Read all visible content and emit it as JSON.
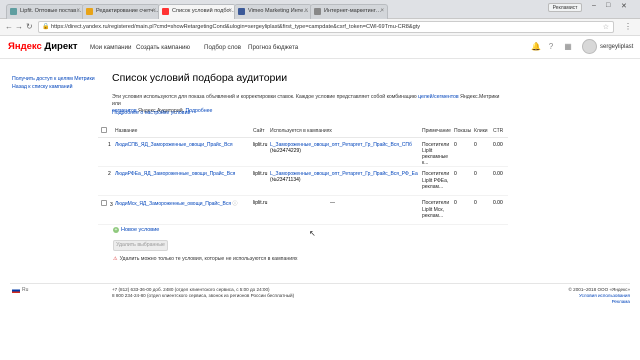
{
  "browser": {
    "tabs": [
      {
        "title": "Lipfit. Оптовые постав…",
        "favicon_color": "#5f9ea0"
      },
      {
        "title": "Редактирование счетч…",
        "favicon_color": "#e8a317"
      },
      {
        "title": "Список условий подбо…",
        "favicon_color": "#f33"
      },
      {
        "title": "Vimeo Marketing Инте…",
        "favicon_color": "#3b5998"
      },
      {
        "title": "Интернет-маркетинг…",
        "favicon_color": "#888"
      }
    ],
    "profile_chip": "Рекламист",
    "url": "https://direct.yandex.ru/registered/main.pl?cmd=showRetargetingCond&ulogin=sergeyliplast&first_type=campdate&csrf_token=CWl-69Tmu-CR8&gty"
  },
  "header": {
    "logo_ya": "Яндекс",
    "logo_rest": " Директ",
    "nav": [
      "Мои кампании",
      "Создать кампанию",
      "Подбор слов",
      "Прогноз бюджета"
    ],
    "username": "sergeyliplast"
  },
  "sidebar": {
    "links": [
      "Получить доступ к целям Метрики",
      "Назад к списку кампаний"
    ]
  },
  "main": {
    "title": "Список условий подбора аудитории",
    "desc_1": "Эти условия используются для показа объявлений и корректировки ставок. Каждое условие представляет собой комбинацию ",
    "desc_link_1": "целей/сегментов",
    "desc_2": " Яндекс.Метрики или",
    "desc_link_2": "сегментов",
    "desc_3": " Яндекс.Аудиторий. ",
    "desc_link_3": "Подробнее",
    "settings_link": "Подробнее о настройке условий",
    "columns": [
      "Название",
      "Сайт",
      "Используется в кампаниях",
      "Примечание",
      "Показы",
      "Клики",
      "CTR"
    ],
    "rows": [
      {
        "num": "1",
        "name": "ЛюдиСПБ_ЯД_Замороженные_овощи_Прайс_Вся",
        "site": "liplit.ru",
        "campaign": "L_Замороженные_овощи_опт_Ретаргет_Гр_Прайс_Вся_СПб",
        "campaign_id": "(№23474229)",
        "note": "Посетители Liplit рекламные к...",
        "shows": "0",
        "clicks": "0",
        "ctr": "0.00"
      },
      {
        "num": "2",
        "name": "ЛюдиРФЕа_ЯД_Замороженные_овощи_Прайс_Вся",
        "site": "liplit.ru",
        "campaign": "L_Замороженные_овощи_опт_Ретаргет_Гр_Прайс_Вся_РФ_Ea",
        "campaign_id": "(№23471134)",
        "note": "Посетители Liplit РФЕа, реклам...",
        "shows": "0",
        "clicks": "0",
        "ctr": "0.00"
      },
      {
        "num": "3",
        "name": "ЛюдиМск_ЯД_Замороженные_овощи_Прайс_Вся",
        "site": "liplit.ru",
        "campaign": "—",
        "campaign_id": "",
        "note": "Посетители Liplit Мск, реклам...",
        "shows": "0",
        "clicks": "0",
        "ctr": "0.00"
      }
    ],
    "new_condition": "Новое условие",
    "delete_button": "Удалить выбранные",
    "warning": "Удалить можно только те условия, которые не используются в кампаниях"
  },
  "footer": {
    "lang": "Ru",
    "contacts_1": "+7 (812) 633-36-00 доб. 2480 (отдел клиентского сервиса, с 5:00 до 24:00)",
    "contacts_2": "8 800 234-24-80 (отдел клиентского сервиса, звонок из регионов России бесплатный)",
    "copyright": "© 2001–2018  ООО «Яндекс»",
    "terms": "Условия использования",
    "ads": "Реклама"
  }
}
